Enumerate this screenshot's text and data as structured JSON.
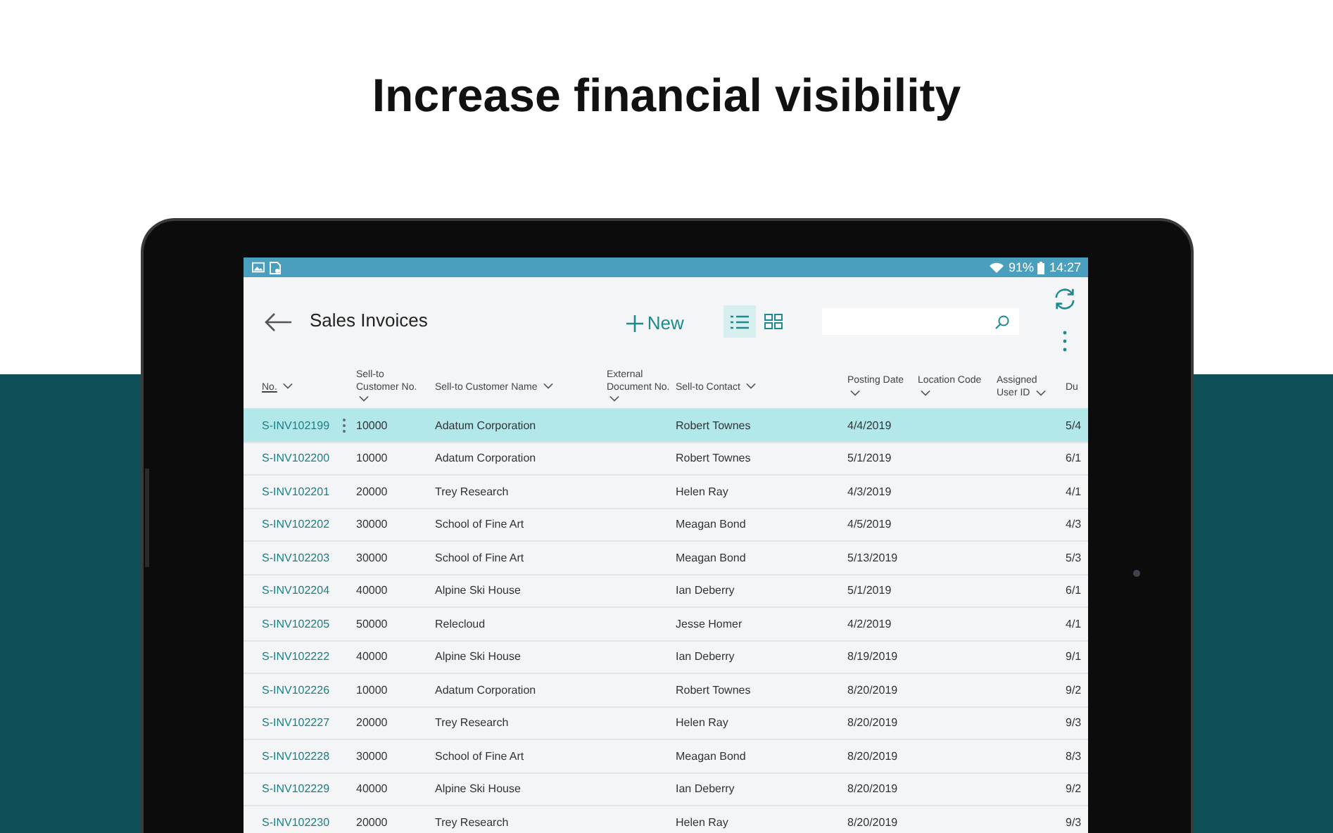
{
  "headline": "Increase financial visibility",
  "status_bar": {
    "battery": "91%",
    "time": "14:27"
  },
  "page": {
    "title": "Sales Invoices",
    "new_button": "New",
    "views": [
      {
        "kind": "list",
        "selected": true
      },
      {
        "kind": "tiles",
        "selected": false
      }
    ]
  },
  "table": {
    "columns": [
      {
        "label": "No.",
        "sorted": true
      },
      {
        "label": "Sell-to Customer No.",
        "sorted": false
      },
      {
        "label": "Sell-to Customer Name",
        "sorted": false
      },
      {
        "label": "External Document No.",
        "sorted": false
      },
      {
        "label": "Sell-to Contact",
        "sorted": false
      },
      {
        "label": "Posting Date",
        "sorted": false
      },
      {
        "label": "Location Code",
        "sorted": false
      },
      {
        "label": "Assigned User ID",
        "sorted": false
      },
      {
        "label": "Du",
        "sorted": false
      }
    ],
    "rows": [
      {
        "selected": true,
        "cells": [
          "S-INV102199",
          "10000",
          "Adatum Corporation",
          "",
          "Robert Townes",
          "4/4/2019",
          "",
          "",
          "5/4"
        ]
      },
      {
        "selected": false,
        "cells": [
          "S-INV102200",
          "10000",
          "Adatum Corporation",
          "",
          "Robert Townes",
          "5/1/2019",
          "",
          "",
          "6/1"
        ]
      },
      {
        "selected": false,
        "cells": [
          "S-INV102201",
          "20000",
          "Trey Research",
          "",
          "Helen Ray",
          "4/3/2019",
          "",
          "",
          "4/1"
        ]
      },
      {
        "selected": false,
        "cells": [
          "S-INV102202",
          "30000",
          "School of Fine Art",
          "",
          "Meagan Bond",
          "4/5/2019",
          "",
          "",
          "4/3"
        ]
      },
      {
        "selected": false,
        "cells": [
          "S-INV102203",
          "30000",
          "School of Fine Art",
          "",
          "Meagan Bond",
          "5/13/2019",
          "",
          "",
          "5/3"
        ]
      },
      {
        "selected": false,
        "cells": [
          "S-INV102204",
          "40000",
          "Alpine Ski House",
          "",
          "Ian Deberry",
          "5/1/2019",
          "",
          "",
          "6/1"
        ]
      },
      {
        "selected": false,
        "cells": [
          "S-INV102205",
          "50000",
          "Relecloud",
          "",
          "Jesse Homer",
          "4/2/2019",
          "",
          "",
          "4/1"
        ]
      },
      {
        "selected": false,
        "cells": [
          "S-INV102222",
          "40000",
          "Alpine Ski House",
          "",
          "Ian Deberry",
          "8/19/2019",
          "",
          "",
          "9/1"
        ]
      },
      {
        "selected": false,
        "cells": [
          "S-INV102226",
          "10000",
          "Adatum Corporation",
          "",
          "Robert Townes",
          "8/20/2019",
          "",
          "",
          "9/2"
        ]
      },
      {
        "selected": false,
        "cells": [
          "S-INV102227",
          "20000",
          "Trey Research",
          "",
          "Helen Ray",
          "8/20/2019",
          "",
          "",
          "9/3"
        ]
      },
      {
        "selected": false,
        "cells": [
          "S-INV102228",
          "30000",
          "School of Fine Art",
          "",
          "Meagan Bond",
          "8/20/2019",
          "",
          "",
          "8/3"
        ]
      },
      {
        "selected": false,
        "cells": [
          "S-INV102229",
          "40000",
          "Alpine Ski House",
          "",
          "Ian Deberry",
          "8/20/2019",
          "",
          "",
          "9/2"
        ]
      },
      {
        "selected": false,
        "cells": [
          "S-INV102230",
          "20000",
          "Trey Research",
          "",
          "Helen Ray",
          "8/20/2019",
          "",
          "",
          "9/3"
        ]
      }
    ]
  }
}
